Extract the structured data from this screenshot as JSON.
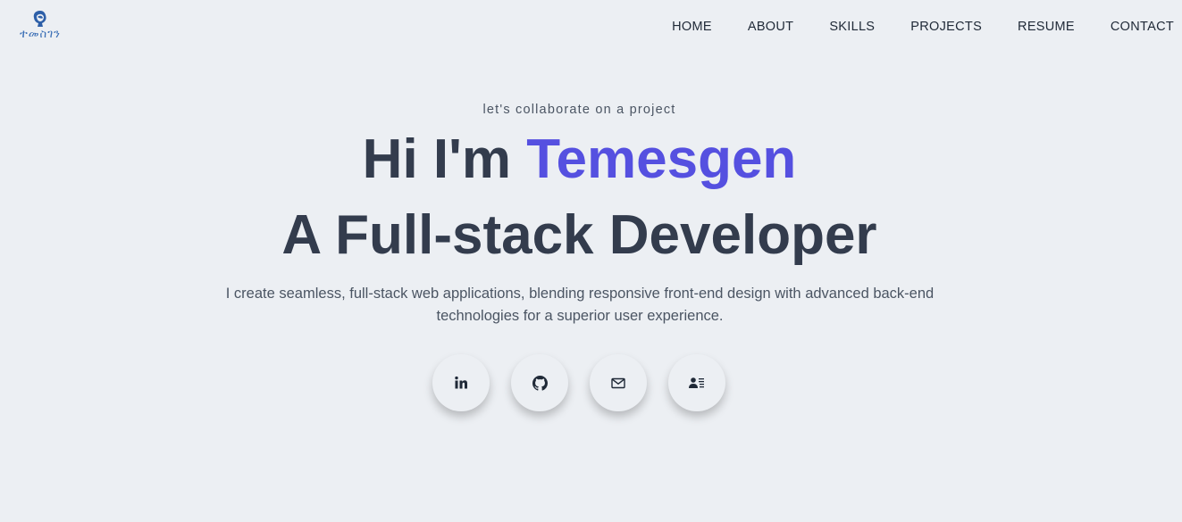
{
  "header": {
    "logo_text": "ተመስገን",
    "logo_icon": "portrait-logo-icon",
    "nav": [
      {
        "label": "HOME"
      },
      {
        "label": "ABOUT"
      },
      {
        "label": "SKILLS"
      },
      {
        "label": "PROJECTS"
      },
      {
        "label": "RESUME"
      },
      {
        "label": "CONTACT"
      }
    ]
  },
  "hero": {
    "tagline": "let's collaborate on a project",
    "greeting": "Hi I'm ",
    "name": "Temesgen",
    "role": "A Full-stack Developer",
    "description": "I create seamless, full-stack web applications, blending responsive front-end design with advanced back-end technologies for a superior user experience."
  },
  "socials": [
    {
      "icon": "linkedin-icon"
    },
    {
      "icon": "github-icon"
    },
    {
      "icon": "mail-icon"
    },
    {
      "icon": "contact-card-icon"
    }
  ],
  "colors": {
    "background": "#eceff3",
    "accent": "#5550e0",
    "heading": "#333c4d",
    "logo": "#3b6fb6"
  }
}
